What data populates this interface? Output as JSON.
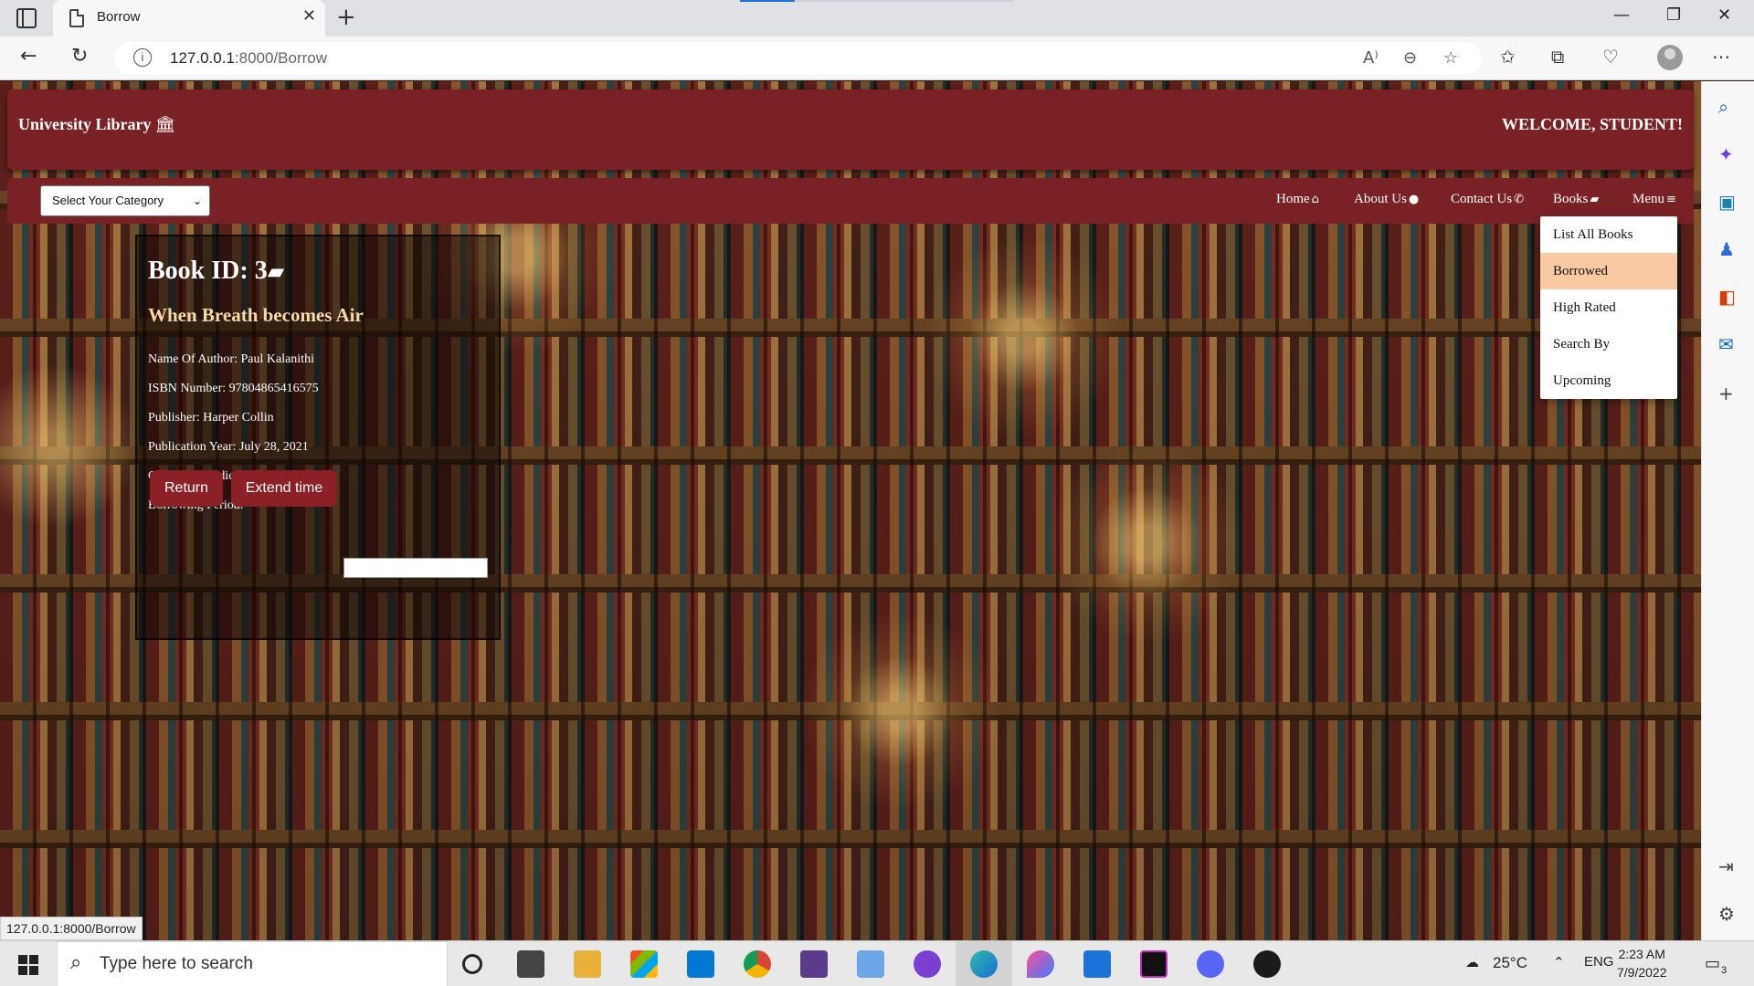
{
  "browser": {
    "tab_title": "Borrow",
    "url_host": "127.0.0.1",
    "url_path": ":8000/Borrow",
    "status_url": "127.0.0.1:8000/Borrow"
  },
  "header": {
    "brand": "University Library",
    "welcome": "WELCOME, STUDENT!"
  },
  "nav": {
    "category_select": "Select Your Category",
    "links": [
      "Home",
      "About Us",
      "Contact Us",
      "Books",
      "Menu"
    ]
  },
  "books_menu": {
    "items": [
      "List All Books",
      "Borrowed",
      "High Rated",
      "Search By",
      "Upcoming"
    ],
    "active": "Borrowed"
  },
  "book": {
    "id_label": "Book ID: 3",
    "name": "When Breath becomes Air",
    "author": "Name Of Author: Paul Kalanithi",
    "isbn": "ISBN Number: 97804865416575",
    "publisher": "Publisher: Harper Collin",
    "year": "Publication Year: July 28, 2021",
    "category": "Category: Medicne",
    "period": "Borrowing Period:",
    "return_label": "Return",
    "extend_label": "Extend time"
  },
  "taskbar": {
    "search_placeholder": "Type here to search",
    "temperature": "25°C",
    "language": "ENG",
    "time": "2:23 AM",
    "date": "7/9/2022",
    "notifications": "3"
  },
  "colors": {
    "header_bg": "#7a2125",
    "button_bg": "#8b2126",
    "active_menu": "#f9c9a3",
    "book_name": "#f6d9a8"
  }
}
